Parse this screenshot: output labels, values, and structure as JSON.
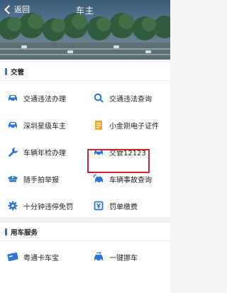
{
  "header": {
    "back_label": "返回",
    "title": "车主"
  },
  "sections": [
    {
      "title": "交管",
      "items": [
        {
          "label": "交通违法办理",
          "icon": "car-icon",
          "color": "#2d74d6"
        },
        {
          "label": "交通违法查询",
          "icon": "search-icon",
          "color": "#2d74d6"
        },
        {
          "label": "深圳星级车主",
          "icon": "car-icon",
          "color": "#2d74d6"
        },
        {
          "label": "小金刚电子证件",
          "icon": "document-icon",
          "color": "#f5a623"
        },
        {
          "label": "车辆年检办理",
          "icon": "wrench-icon",
          "color": "#2d74d6"
        },
        {
          "label": "交管12123",
          "icon": "car-icon",
          "color": "#2d74d6"
        },
        {
          "label": "随手拍举报",
          "icon": "police-cap-icon",
          "color": "#2d74d6"
        },
        {
          "label": "车辆事故查询",
          "icon": "car-crash-icon",
          "color": "#2d74d6"
        },
        {
          "label": "十分钟违停免罚",
          "icon": "gear-icon",
          "color": "#2d74d6"
        },
        {
          "label": "罚单缴费",
          "icon": "receipt-icon",
          "color": "#2d74d6"
        }
      ]
    },
    {
      "title": "用车服务",
      "items": [
        {
          "label": "粤通卡车宝",
          "icon": "card-icon",
          "color": "#2d74d6"
        },
        {
          "label": "一键挪车",
          "icon": "car-move-icon",
          "color": "#2d74d6"
        }
      ]
    }
  ],
  "highlighted_item": "交管12123"
}
